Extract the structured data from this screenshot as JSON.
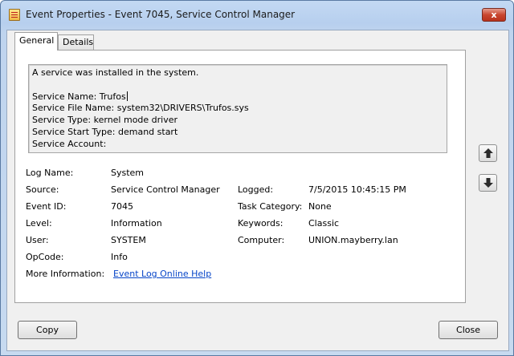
{
  "window": {
    "title": "Event Properties - Event 7045, Service Control Manager",
    "close_symbol": "x",
    "app_icon": "event-viewer-icon"
  },
  "tabs": [
    {
      "label": "General",
      "selected": true
    },
    {
      "label": "Details",
      "selected": false
    }
  ],
  "description": {
    "line1": "A service was installed in the system.",
    "line2": "",
    "service_name": "Service Name:  Trufos",
    "service_file_name": "Service File Name:  system32\\DRIVERS\\Trufos.sys",
    "service_type": "Service Type:  kernel mode driver",
    "service_start_type": "Service Start Type:  demand start",
    "service_account": "Service Account:"
  },
  "fields": {
    "log_name": {
      "label": "Log Name:",
      "value": "System"
    },
    "source": {
      "label": "Source:",
      "value": "Service Control Manager"
    },
    "logged": {
      "label": "Logged:",
      "value": "7/5/2015 10:45:15 PM"
    },
    "event_id": {
      "label": "Event ID:",
      "value": "7045"
    },
    "task_category": {
      "label": "Task Category:",
      "value": "None"
    },
    "level": {
      "label": "Level:",
      "value": "Information"
    },
    "keywords": {
      "label": "Keywords:",
      "value": "Classic"
    },
    "user": {
      "label": "User:",
      "value": "SYSTEM"
    },
    "computer": {
      "label": "Computer:",
      "value": "UNION.mayberry.lan"
    },
    "opcode": {
      "label": "OpCode:",
      "value": "Info"
    },
    "more_info": {
      "label": "More Information:",
      "link": "Event Log Online Help"
    }
  },
  "nav": {
    "up_icon": "arrow-up-icon",
    "down_icon": "arrow-down-icon"
  },
  "buttons": {
    "copy": "Copy",
    "close": "Close"
  },
  "colors": {
    "link": "#0645c8",
    "close_button": "#c9462f"
  }
}
